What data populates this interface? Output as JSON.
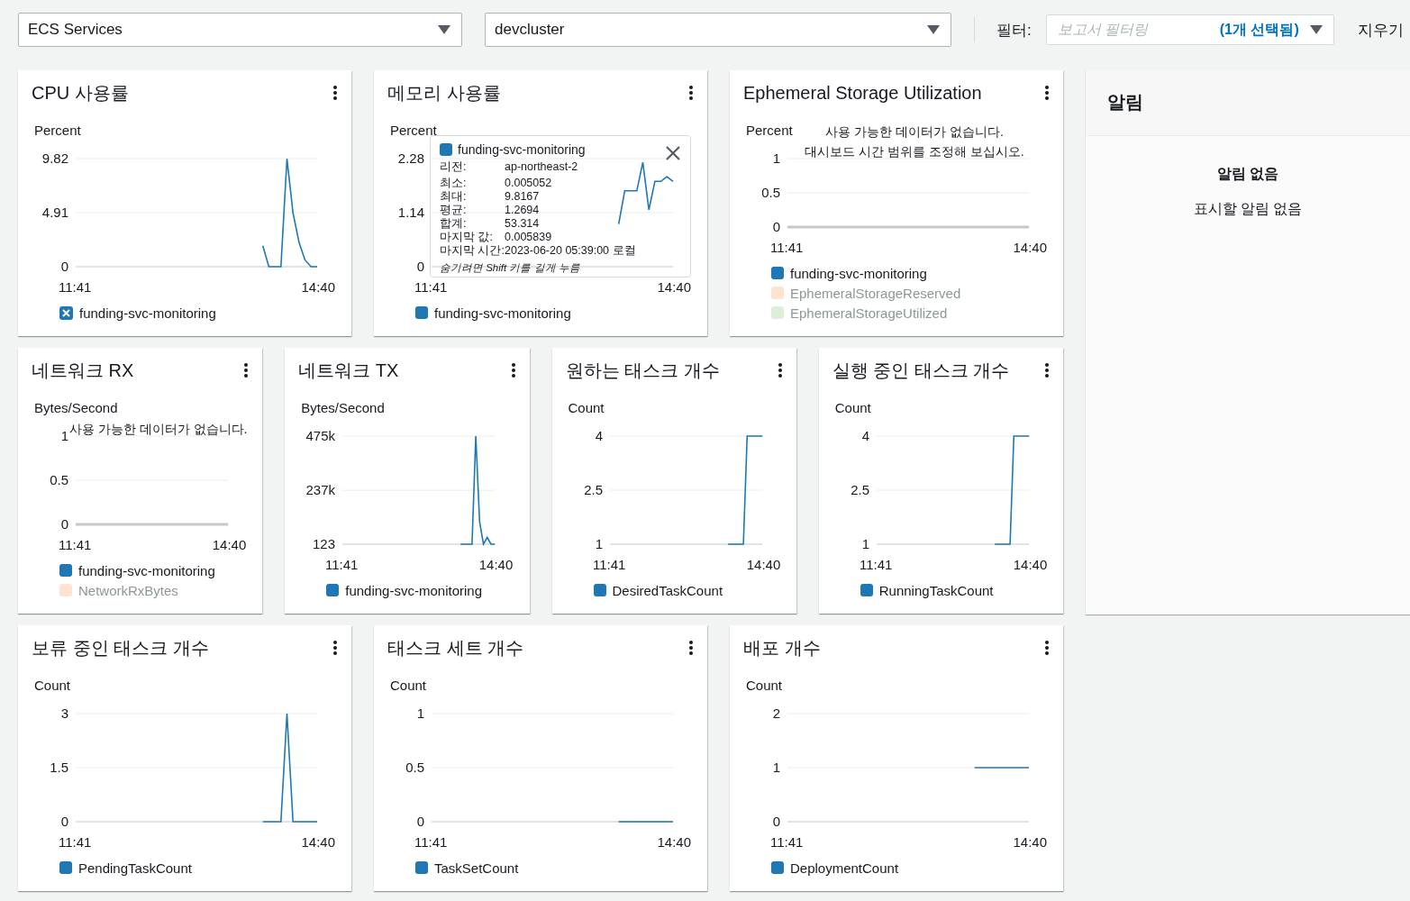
{
  "top_bar": {
    "service_select": "ECS Services",
    "cluster_select": "devcluster",
    "filter_label": "필터:",
    "filter_field": {
      "placeholder": "보고서 필터링",
      "selection": "(1개 선택됨)"
    },
    "clear_button": "지우기"
  },
  "rows": [
    [
      {
        "title": "CPU 사용률",
        "unit": "Percent",
        "chart_data": {
          "type": "line",
          "categories": [
            "11:41",
            null,
            null,
            null,
            null,
            null,
            null,
            null,
            null,
            null,
            null,
            null,
            null,
            null,
            null,
            null,
            null,
            null,
            null,
            null,
            null,
            null,
            null,
            null,
            null,
            null,
            null,
            null,
            null,
            null,
            null,
            null,
            null,
            null,
            null,
            null,
            null,
            null,
            null,
            null,
            "14:40"
          ],
          "series": [
            {
              "color": "#1f77b4",
              "values": [
                null,
                null,
                null,
                null,
                null,
                null,
                null,
                null,
                null,
                null,
                null,
                null,
                null,
                null,
                null,
                null,
                null,
                null,
                null,
                null,
                null,
                null,
                null,
                null,
                null,
                null,
                null,
                null,
                null,
                null,
                null,
                1.9,
                0,
                0,
                0,
                9.8,
                4.9,
                2.2,
                0.6,
                0,
                0
              ]
            }
          ],
          "ylim": [
            0,
            9.82
          ],
          "yticks": [
            0,
            4.91,
            9.82
          ]
        },
        "legend": [
          {
            "label": "funding-svc-monitoring",
            "color": "#1f77b4",
            "kind": "remove",
            "hidden": false
          }
        ]
      },
      {
        "title": "메모리 사용률",
        "unit": "Percent",
        "chart_data": {
          "type": "line",
          "categories": [
            "11:41",
            null,
            null,
            null,
            null,
            null,
            null,
            null,
            null,
            null,
            null,
            null,
            null,
            null,
            null,
            null,
            null,
            null,
            null,
            null,
            null,
            null,
            null,
            null,
            null,
            null,
            null,
            null,
            null,
            null,
            null,
            null,
            null,
            null,
            null,
            null,
            null,
            null,
            null,
            null,
            "14:40"
          ],
          "series": [
            {
              "color": "#1f77b4",
              "values": [
                null,
                null,
                null,
                null,
                null,
                null,
                null,
                null,
                null,
                null,
                null,
                null,
                null,
                null,
                null,
                null,
                null,
                null,
                null,
                null,
                null,
                null,
                null,
                null,
                null,
                null,
                null,
                null,
                null,
                null,
                null,
                0.9,
                1.6,
                1.6,
                1.6,
                2.2,
                1.2,
                1.8,
                1.8,
                1.9,
                1.8
              ]
            }
          ],
          "ylim": [
            0,
            2.28
          ],
          "yticks": [
            0,
            1.14,
            2.28
          ]
        },
        "legend": [
          {
            "label": "funding-svc-monitoring",
            "color": "#1f77b4",
            "kind": "swatch",
            "hidden": false
          }
        ],
        "tooltip": {
          "series": "funding-svc-monitoring",
          "color": "#1f77b4",
          "rows": [
            {
              "label": "리전:",
              "value": "ap-northeast-2"
            },
            {
              "label": "최소:",
              "value": "0.005052"
            },
            {
              "label": "최대:",
              "value": "9.8167"
            },
            {
              "label": "평균:",
              "value": "1.2694"
            },
            {
              "label": "합계:",
              "value": "53.314"
            },
            {
              "label": "마지막 값:",
              "value": "0.005839"
            },
            {
              "label": "마지막 시간:",
              "value": "2023-06-20 05:39:00 로컬"
            }
          ],
          "hint": "숨기려면 Shift 키를 길게 누름"
        }
      },
      {
        "title": "Ephemeral Storage Utilization",
        "unit": "Percent",
        "no_data_message": [
          "사용 가능한 데이터가 없습니다.",
          "대시보드 시간 범위를 조정해 보십시오."
        ],
        "empty_axis": {
          "yticks": [
            "1",
            "0.5",
            "0"
          ],
          "xlabels": [
            "11:41",
            "14:40"
          ]
        },
        "legend": [
          {
            "label": "funding-svc-monitoring",
            "color": "#1f77b4",
            "kind": "swatch",
            "hidden": false
          },
          {
            "label": "EphemeralStorageReserved",
            "color": "#fde3d0",
            "kind": "swatch",
            "hidden": true
          },
          {
            "label": "EphemeralStorageUtilized",
            "color": "#dcefd9",
            "kind": "swatch",
            "hidden": true
          }
        ]
      }
    ],
    [
      {
        "title": "네트워크 RX",
        "unit": "Bytes/Second",
        "no_data_message": [
          "사용 가능한 데이터가 없습니다."
        ],
        "empty_axis": {
          "yticks": [
            "1",
            "0.5",
            "0"
          ],
          "xlabels": [
            "11:41",
            "14:40"
          ]
        },
        "legend": [
          {
            "label": "funding-svc-monitoring",
            "color": "#1f77b4",
            "kind": "swatch",
            "hidden": false
          },
          {
            "label": "NetworkRxBytes",
            "color": "#fde3d0",
            "kind": "swatch",
            "hidden": true
          }
        ]
      },
      {
        "title": "네트워크 TX",
        "unit": "Bytes/Second",
        "chart_data": {
          "type": "line",
          "categories": [
            "11:41",
            null,
            null,
            null,
            null,
            null,
            null,
            null,
            null,
            null,
            null,
            null,
            null,
            null,
            null,
            null,
            null,
            null,
            null,
            null,
            null,
            null,
            null,
            null,
            null,
            null,
            null,
            null,
            null,
            null,
            null,
            null,
            null,
            null,
            null,
            null,
            null,
            null,
            null,
            null,
            "14:40"
          ],
          "series": [
            {
              "color": "#1f77b4",
              "values": [
                null,
                null,
                null,
                null,
                null,
                null,
                null,
                null,
                null,
                null,
                null,
                null,
                null,
                null,
                null,
                null,
                null,
                null,
                null,
                null,
                null,
                null,
                null,
                null,
                null,
                null,
                null,
                null,
                null,
                null,
                null,
                123,
                123,
                123,
                123,
                475000,
                100000,
                123,
                30000,
                123,
                123
              ]
            }
          ],
          "ylim": [
            123,
            475000
          ],
          "yticks": [
            123,
            {
              "value": 237000,
              "label": "237k"
            },
            {
              "value": 475000,
              "label": "475k"
            }
          ]
        },
        "legend": [
          {
            "label": "funding-svc-monitoring",
            "color": "#1f77b4",
            "kind": "swatch",
            "hidden": false
          }
        ]
      },
      {
        "title": "원하는 태스크 개수",
        "unit": "Count",
        "chart_data": {
          "type": "line",
          "categories": [
            "11:41",
            null,
            null,
            null,
            null,
            null,
            null,
            null,
            null,
            null,
            null,
            null,
            null,
            null,
            null,
            null,
            null,
            null,
            null,
            null,
            null,
            null,
            null,
            null,
            null,
            null,
            null,
            null,
            null,
            null,
            null,
            null,
            null,
            null,
            null,
            null,
            null,
            null,
            null,
            null,
            "14:40"
          ],
          "series": [
            {
              "color": "#1f77b4",
              "values": [
                null,
                null,
                null,
                null,
                null,
                null,
                null,
                null,
                null,
                null,
                null,
                null,
                null,
                null,
                null,
                null,
                null,
                null,
                null,
                null,
                null,
                null,
                null,
                null,
                null,
                null,
                null,
                null,
                null,
                null,
                null,
                1,
                1,
                1,
                1,
                1,
                4,
                4,
                4,
                4,
                4
              ]
            }
          ],
          "ylim": [
            1,
            4
          ],
          "yticks": [
            1,
            2.5,
            4
          ]
        },
        "legend": [
          {
            "label": "DesiredTaskCount",
            "color": "#1f77b4",
            "kind": "swatch",
            "hidden": false
          }
        ]
      },
      {
        "title": "실행 중인 태스크 개수",
        "unit": "Count",
        "chart_data": {
          "type": "line",
          "categories": [
            "11:41",
            null,
            null,
            null,
            null,
            null,
            null,
            null,
            null,
            null,
            null,
            null,
            null,
            null,
            null,
            null,
            null,
            null,
            null,
            null,
            null,
            null,
            null,
            null,
            null,
            null,
            null,
            null,
            null,
            null,
            null,
            null,
            null,
            null,
            null,
            null,
            null,
            null,
            null,
            null,
            "14:40"
          ],
          "series": [
            {
              "color": "#1f77b4",
              "values": [
                null,
                null,
                null,
                null,
                null,
                null,
                null,
                null,
                null,
                null,
                null,
                null,
                null,
                null,
                null,
                null,
                null,
                null,
                null,
                null,
                null,
                null,
                null,
                null,
                null,
                null,
                null,
                null,
                null,
                null,
                null,
                1,
                1,
                1,
                1,
                1,
                4,
                4,
                4,
                4,
                4
              ]
            }
          ],
          "ylim": [
            1,
            4
          ],
          "yticks": [
            1,
            2.5,
            4
          ]
        },
        "legend": [
          {
            "label": "RunningTaskCount",
            "color": "#1f77b4",
            "kind": "swatch",
            "hidden": false
          }
        ]
      }
    ],
    [
      {
        "title": "보류 중인 태스크 개수",
        "unit": "Count",
        "chart_data": {
          "type": "line",
          "categories": [
            "11:41",
            null,
            null,
            null,
            null,
            null,
            null,
            null,
            null,
            null,
            null,
            null,
            null,
            null,
            null,
            null,
            null,
            null,
            null,
            null,
            null,
            null,
            null,
            null,
            null,
            null,
            null,
            null,
            null,
            null,
            null,
            null,
            null,
            null,
            null,
            null,
            null,
            null,
            null,
            null,
            "14:40"
          ],
          "series": [
            {
              "color": "#1f77b4",
              "values": [
                null,
                null,
                null,
                null,
                null,
                null,
                null,
                null,
                null,
                null,
                null,
                null,
                null,
                null,
                null,
                null,
                null,
                null,
                null,
                null,
                null,
                null,
                null,
                null,
                null,
                null,
                null,
                null,
                null,
                null,
                null,
                0,
                0,
                0,
                0,
                3,
                0,
                0,
                0,
                0,
                0
              ]
            }
          ],
          "ylim": [
            0,
            3
          ],
          "yticks": [
            0,
            1.5,
            3
          ]
        },
        "legend": [
          {
            "label": "PendingTaskCount",
            "color": "#1f77b4",
            "kind": "swatch",
            "hidden": false
          }
        ]
      },
      {
        "title": "태스크 세트 개수",
        "unit": "Count",
        "chart_data": {
          "type": "line",
          "categories": [
            "11:41",
            null,
            null,
            null,
            null,
            null,
            null,
            null,
            null,
            null,
            null,
            null,
            null,
            null,
            null,
            null,
            null,
            null,
            null,
            null,
            null,
            null,
            null,
            null,
            null,
            null,
            null,
            null,
            null,
            null,
            null,
            null,
            null,
            null,
            null,
            null,
            null,
            null,
            null,
            null,
            "14:40"
          ],
          "series": [
            {
              "color": "#1f77b4",
              "values": [
                null,
                null,
                null,
                null,
                null,
                null,
                null,
                null,
                null,
                null,
                null,
                null,
                null,
                null,
                null,
                null,
                null,
                null,
                null,
                null,
                null,
                null,
                null,
                null,
                null,
                null,
                null,
                null,
                null,
                null,
                null,
                0,
                0,
                0,
                0,
                0,
                0,
                0,
                0,
                0,
                0
              ]
            }
          ],
          "ylim": [
            0,
            1
          ],
          "yticks": [
            0,
            0.5,
            1
          ]
        },
        "legend": [
          {
            "label": "TaskSetCount",
            "color": "#1f77b4",
            "kind": "swatch",
            "hidden": false
          }
        ]
      },
      {
        "title": "배포 개수",
        "unit": "Count",
        "chart_data": {
          "type": "line",
          "categories": [
            "11:41",
            null,
            null,
            null,
            null,
            null,
            null,
            null,
            null,
            null,
            null,
            null,
            null,
            null,
            null,
            null,
            null,
            null,
            null,
            null,
            null,
            null,
            null,
            null,
            null,
            null,
            null,
            null,
            null,
            null,
            null,
            null,
            null,
            null,
            null,
            null,
            null,
            null,
            null,
            null,
            "14:40"
          ],
          "series": [
            {
              "color": "#1f77b4",
              "values": [
                null,
                null,
                null,
                null,
                null,
                null,
                null,
                null,
                null,
                null,
                null,
                null,
                null,
                null,
                null,
                null,
                null,
                null,
                null,
                null,
                null,
                null,
                null,
                null,
                null,
                null,
                null,
                null,
                null,
                null,
                null,
                1,
                1,
                1,
                1,
                1,
                1,
                1,
                1,
                1,
                1
              ]
            }
          ],
          "ylim": [
            0,
            2
          ],
          "yticks": [
            0,
            1,
            2
          ]
        },
        "legend": [
          {
            "label": "DeploymentCount",
            "color": "#1f77b4",
            "kind": "swatch",
            "hidden": false
          }
        ]
      }
    ]
  ],
  "alerts": {
    "title": "알림",
    "empty_title": "알림 없음",
    "empty_message": "표시할 알림 없음"
  }
}
